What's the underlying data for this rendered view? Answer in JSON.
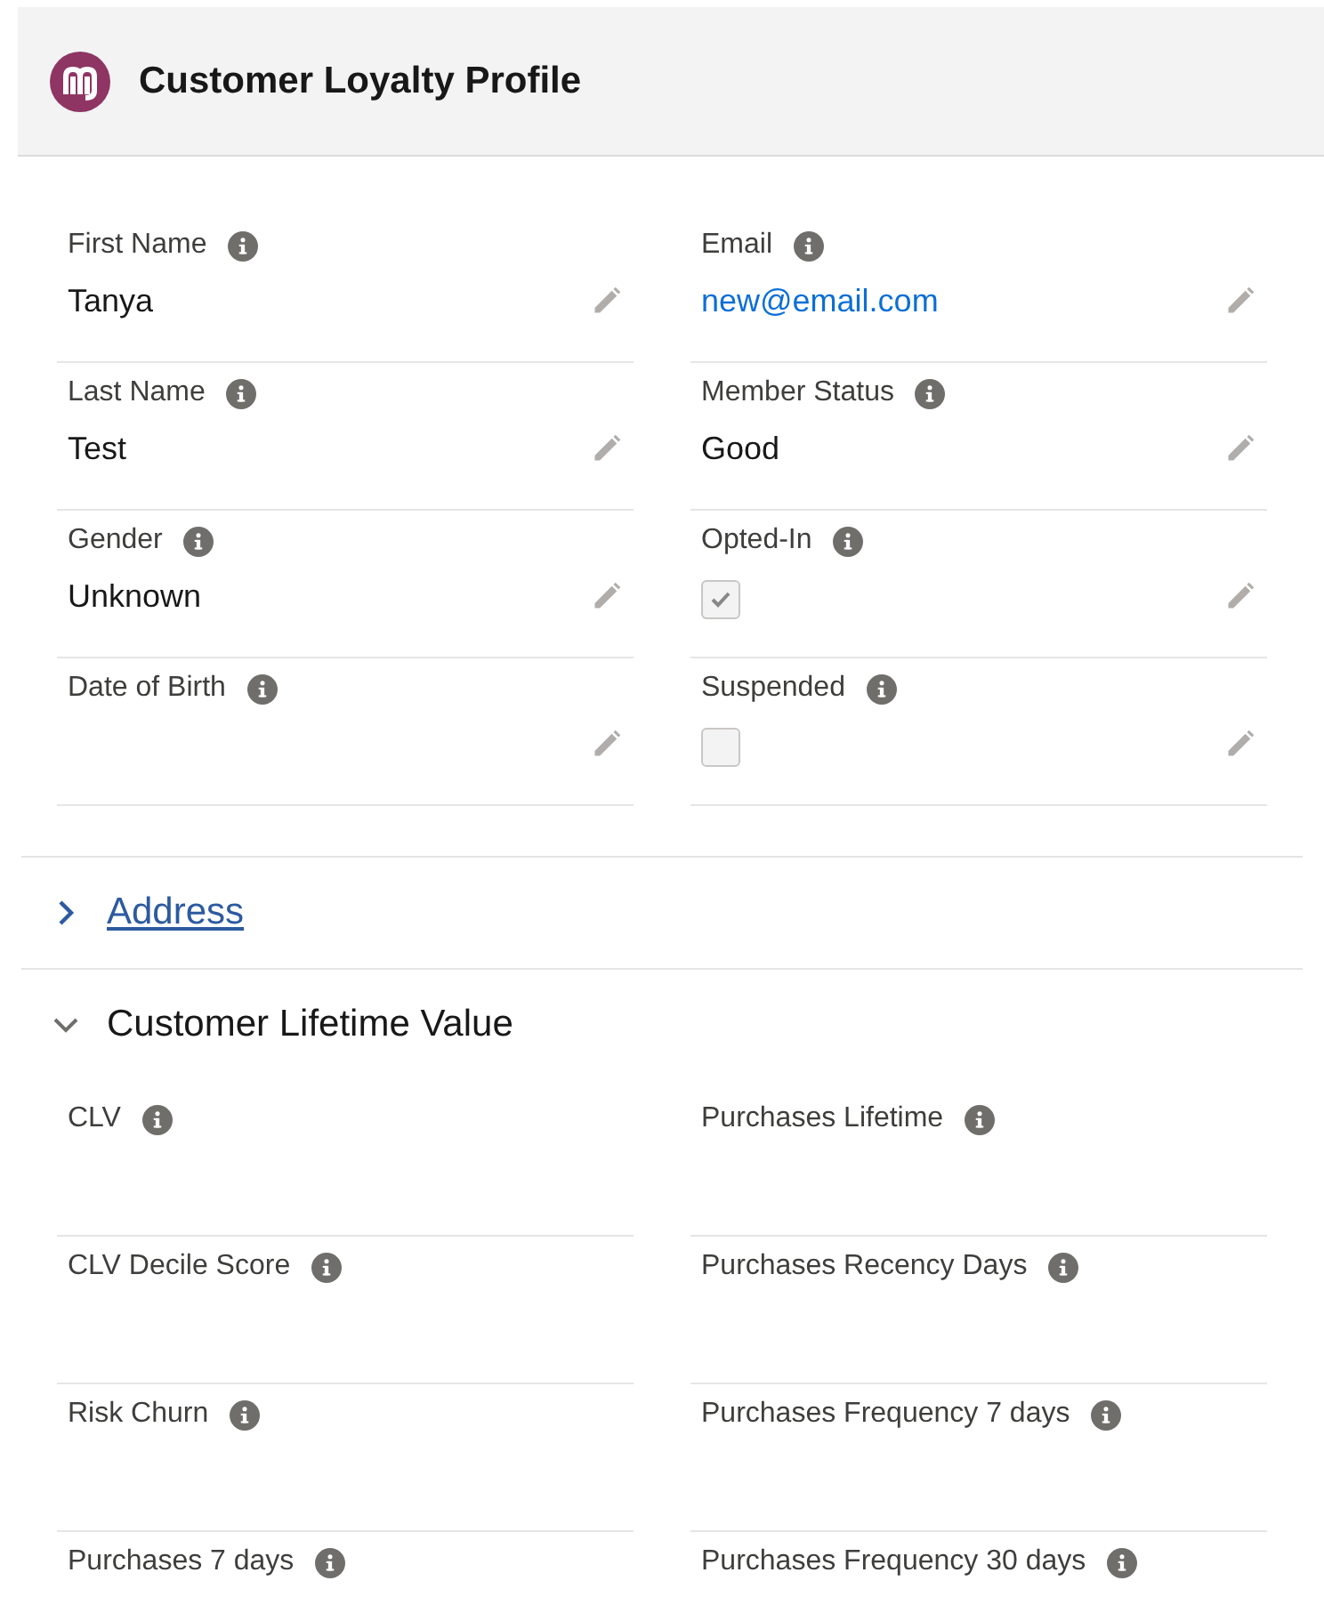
{
  "header": {
    "title": "Customer Loyalty Profile"
  },
  "sections": [
    {
      "fields": [
        {
          "label": "First Name",
          "kind": "text",
          "value": "Tanya",
          "editable": true
        },
        {
          "label": "Email",
          "kind": "link",
          "value": "new@email.com",
          "editable": true
        },
        {
          "label": "Last Name",
          "kind": "text",
          "value": "Test",
          "editable": true
        },
        {
          "label": "Member Status",
          "kind": "text",
          "value": "Good",
          "editable": true
        },
        {
          "label": "Gender",
          "kind": "text",
          "value": "Unknown",
          "editable": true
        },
        {
          "label": "Opted-In",
          "kind": "checkbox",
          "checked": true,
          "editable": true
        },
        {
          "label": "Date of Birth",
          "kind": "text",
          "editable": true
        },
        {
          "label": "Suspended",
          "kind": "checkbox",
          "checked": false,
          "editable": true
        }
      ]
    },
    {
      "title": "Address",
      "expanded": false
    },
    {
      "title": "Customer Lifetime Value",
      "expanded": true,
      "fields": [
        {
          "label": "CLV",
          "kind": "text",
          "editable": false
        },
        {
          "label": "Purchases Lifetime",
          "kind": "text",
          "editable": false
        },
        {
          "label": "CLV Decile Score",
          "kind": "text",
          "editable": false
        },
        {
          "label": "Purchases Recency Days",
          "kind": "text",
          "editable": false
        },
        {
          "label": "Risk Churn",
          "kind": "text",
          "editable": false
        },
        {
          "label": "Purchases Frequency 7 days",
          "kind": "text",
          "editable": false
        },
        {
          "label": "Purchases 7 days",
          "kind": "text",
          "editable": false
        },
        {
          "label": "Purchases Frequency 30 days",
          "kind": "text",
          "editable": false
        }
      ]
    }
  ]
}
